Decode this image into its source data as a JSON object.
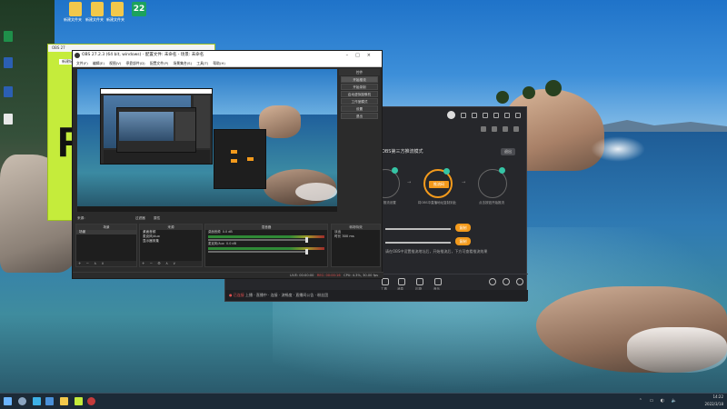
{
  "desktop": {
    "icons": [
      {
        "label": "新建文件夹",
        "color": "#f2c84b"
      },
      {
        "label": "新建文件夹",
        "color": "#f2c84b"
      },
      {
        "label": "新建文件夹",
        "color": "#f2c84b"
      },
      {
        "label": "22",
        "color": "#1ca25d"
      }
    ]
  },
  "green_window": {
    "title": "OBS 27",
    "tab": "新建标签",
    "big_letter": "R"
  },
  "obs": {
    "title": "OBS 27.2.3 (64 bit, windows) - 配置文件: 未命名 - 场景: 未命名",
    "menu": [
      "文件(F)",
      "编辑(E)",
      "视图(V)",
      "停靠部件(D)",
      "配置文件(P)",
      "场景集合(S)",
      "工具(T)",
      "帮助(H)"
    ],
    "controls": {
      "title": "控件",
      "buttons": [
        "开始推流",
        "开始录制",
        "启动虚拟摄像机",
        "工作室模式",
        "设置",
        "退出"
      ]
    },
    "scene_tabs": [
      "来源：",
      "过滤器",
      "属性"
    ],
    "scenes": {
      "title": "场景",
      "items": [
        "场景"
      ]
    },
    "sources": {
      "title": "来源",
      "items": [
        "桌面音频",
        "麦克风/Aux",
        "显示器采集"
      ]
    },
    "mixer": {
      "title": "混音器",
      "channels": [
        {
          "name": "桌面音频",
          "db": "0.0 dB"
        },
        {
          "name": "麦克风/Aux",
          "db": "0.0 dB"
        }
      ]
    },
    "transitions": {
      "title": "转场特效",
      "type": "淡出",
      "duration_label": "时长",
      "duration": "300 ms"
    },
    "status": {
      "live": "LIVE: 00:00:00",
      "rec": "REC: 00:00:16",
      "cpu": "CPU: 4.3%, 30.00 fps"
    }
  },
  "recorder": {
    "mode_title": "OBS第三方推流模式",
    "mode_button": "退出",
    "steps": [
      {
        "caption": "第一步 推流设置",
        "button": ""
      },
      {
        "caption": "将OBS中直播地址复制到此",
        "button": "推流码"
      },
      {
        "caption": "点击按钮开始推流",
        "button": ""
      }
    ],
    "hint": "请在OBS中设置推流地址后，开始推流后，下方可查看推流效果",
    "orange_buttons": [
      "复制",
      "复制"
    ],
    "bottom_tools": [
      "工具",
      "消息",
      "礼物",
      "音乐",
      "开播"
    ],
    "status_text": "上播 · 直播中 · 连接 · 流畅度 · 直播间公告 · 粉丝团",
    "red_text": "● 已连接"
  },
  "taskbar": {
    "time": "14:22",
    "date": "2022/3/18",
    "lang": "中"
  }
}
